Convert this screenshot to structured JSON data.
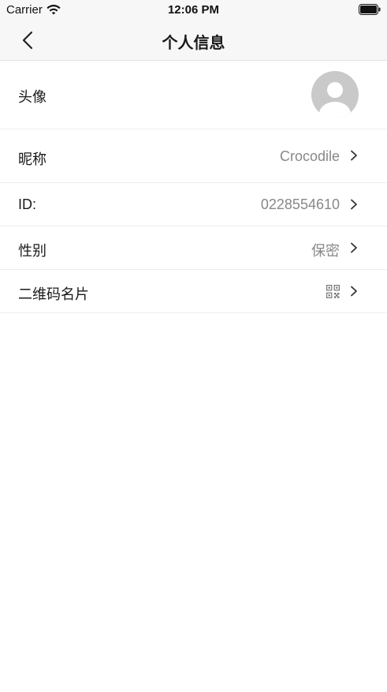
{
  "status_bar": {
    "carrier": "Carrier",
    "time": "12:06 PM",
    "wifi_icon": "wifi-icon",
    "battery_icon": "battery-icon"
  },
  "nav": {
    "title": "个人信息",
    "back_icon": "chevron-left-icon"
  },
  "rows": {
    "avatar": {
      "label": "头像",
      "icon": "avatar-placeholder-icon"
    },
    "nickname": {
      "label": "昵称",
      "value": "Crocodile"
    },
    "id": {
      "label": "ID:",
      "value": "0228554610"
    },
    "gender": {
      "label": "性别",
      "value": "保密"
    },
    "qrcode": {
      "label": "二维码名片",
      "icon": "qr-code-icon"
    }
  },
  "colors": {
    "bar_background": "#f7f7f7",
    "label_text": "#1a1a1a",
    "value_text": "#888888",
    "divider": "#ededed",
    "avatar_bg": "#c9c9c9"
  }
}
